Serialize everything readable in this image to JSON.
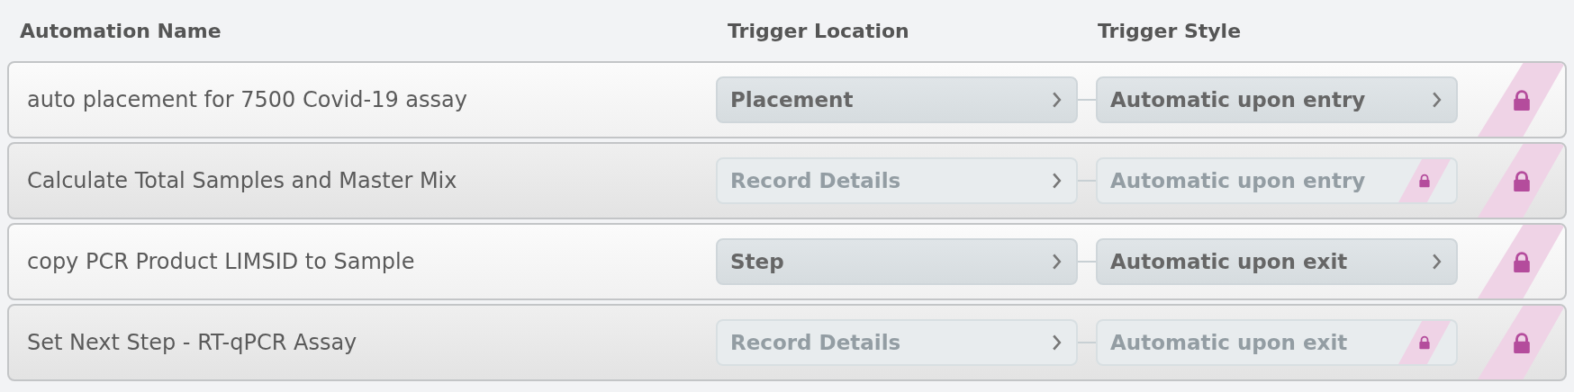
{
  "table": {
    "columns": [
      "Automation Name",
      "Trigger Location",
      "Trigger Style"
    ],
    "rows": [
      {
        "name": "auto placement for 7500 Covid-19 assay",
        "trigger_location": "Placement",
        "trigger_style": "Automatic upon entry",
        "disabled": false
      },
      {
        "name": "Calculate Total Samples and Master Mix",
        "trigger_location": "Record Details",
        "trigger_style": "Automatic upon entry",
        "disabled": true
      },
      {
        "name": "copy PCR Product LIMSID to Sample",
        "trigger_location": "Step",
        "trigger_style": "Automatic upon exit",
        "disabled": false
      },
      {
        "name": "Set Next Step - RT-qPCR Assay",
        "trigger_location": "Record Details",
        "trigger_style": "Automatic upon exit",
        "disabled": true
      }
    ]
  }
}
